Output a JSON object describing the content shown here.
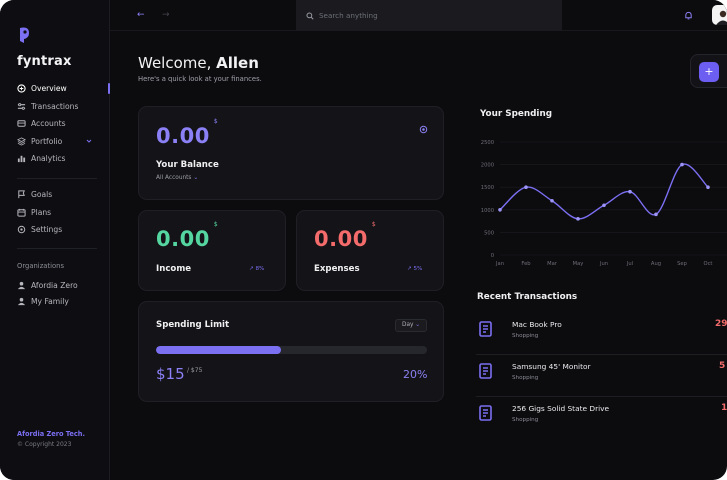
{
  "colors": {
    "accent": "#7b6ff2",
    "income": "#55d6a1",
    "expenses": "#f36b6b",
    "balance": "#8b80f5"
  },
  "brand": {
    "name": "fyntrax"
  },
  "sidebar": {
    "main_items": [
      {
        "label": "Overview",
        "icon": "overview-icon",
        "active": true
      },
      {
        "label": "Transactions",
        "icon": "transactions-icon"
      },
      {
        "label": "Accounts",
        "icon": "accounts-icon"
      },
      {
        "label": "Portfolio",
        "icon": "portfolio-icon",
        "has_dropdown": true
      },
      {
        "label": "Analytics",
        "icon": "analytics-icon"
      }
    ],
    "secondary_items": [
      {
        "label": "Goals",
        "icon": "flag-icon"
      },
      {
        "label": "Plans",
        "icon": "calendar-icon"
      },
      {
        "label": "Settings",
        "icon": "gear-icon"
      }
    ],
    "organizations_title": "Organizations",
    "organizations": [
      {
        "label": "Afordia Zero",
        "icon": "users-icon"
      },
      {
        "label": "My Family",
        "icon": "users-icon"
      }
    ],
    "footer": {
      "org": "Afordia Zero Tech.",
      "copyright": "Copyright 2023"
    }
  },
  "topbar": {
    "search_placeholder": "Search anything"
  },
  "header": {
    "welcome_prefix": "Welcome, ",
    "user_name": "Allen",
    "subtitle": "Here's a quick look at your finances.",
    "add_label": "+"
  },
  "balance": {
    "value": "0.00",
    "currency": "$",
    "label": "Your Balance",
    "account_select": "All Accounts"
  },
  "income": {
    "value": "0.00",
    "currency": "$",
    "label": "Income",
    "trend": "8%"
  },
  "expenses": {
    "value": "0.00",
    "currency": "$",
    "label": "Expenses",
    "trend": "5%"
  },
  "spending_limit": {
    "title": "Spending Limit",
    "period": "Day",
    "spent": "$15",
    "limit": "/ $75",
    "percent_label": "20%",
    "progress": 0.46
  },
  "spending": {
    "title": "Your Spending"
  },
  "chart_data": {
    "type": "line",
    "title": "Your Spending",
    "categories": [
      "Jan",
      "Feb",
      "Mar",
      "May",
      "Jun",
      "Jul",
      "Aug",
      "Sep",
      "Oct"
    ],
    "y_ticks": [
      "0",
      "500",
      "1000",
      "1500",
      "2000",
      "2500"
    ],
    "ylim": [
      0,
      2500
    ],
    "series": [
      {
        "values": [
          1000,
          1500,
          1200,
          800,
          1100,
          1400,
          900,
          2000,
          1500
        ]
      }
    ],
    "grid": true
  },
  "transactions": {
    "title": "Recent Transactions",
    "items": [
      {
        "name": "Mac Book Pro",
        "category": "Shopping",
        "amount": "29"
      },
      {
        "name": "Samsung 45' Monitor",
        "category": "Shopping",
        "amount": "5"
      },
      {
        "name": "256 Gigs Solid State Drive",
        "category": "Shopping",
        "amount": "1"
      }
    ]
  }
}
